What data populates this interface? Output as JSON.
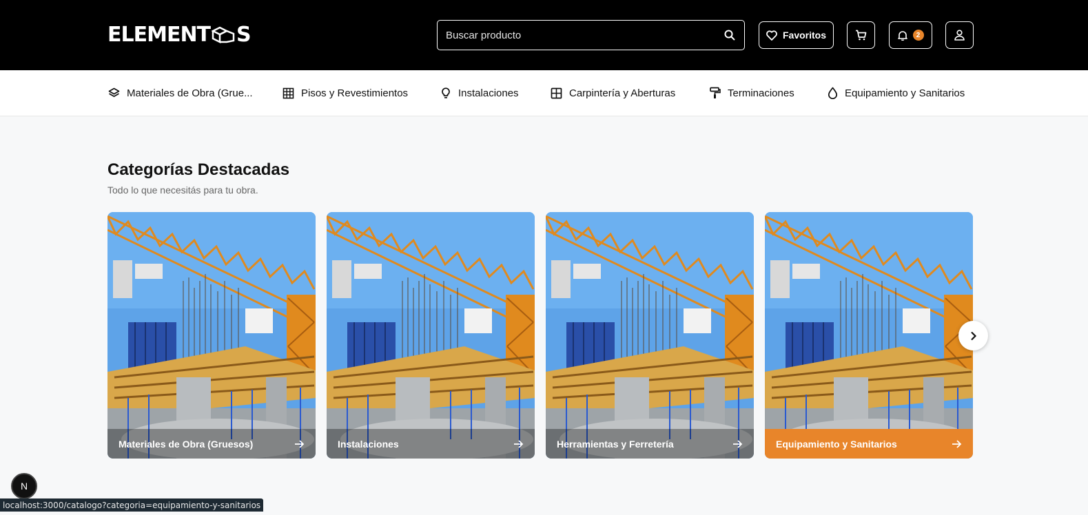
{
  "header": {
    "logo_left": "ELEMENT",
    "logo_right": "S",
    "search_placeholder": "Buscar producto",
    "favorites_label": "Favoritos",
    "notification_count": "2"
  },
  "nav": {
    "items": [
      {
        "label": "Materiales de Obra (Grue...",
        "icon": "layers-icon"
      },
      {
        "label": "Pisos y Revestimientos",
        "icon": "grid-icon"
      },
      {
        "label": "Instalaciones",
        "icon": "lightbulb-icon"
      },
      {
        "label": "Carpintería y Aberturas",
        "icon": "window-icon"
      },
      {
        "label": "Terminaciones",
        "icon": "paint-roller-icon"
      },
      {
        "label": "Equipamiento y Sanitarios",
        "icon": "droplet-icon"
      }
    ]
  },
  "section": {
    "title": "Categorías Destacadas",
    "subtitle": "Todo lo que necesitás para tu obra."
  },
  "cards": [
    {
      "label": "Materiales de Obra (Gruesos)",
      "active": false
    },
    {
      "label": "Instalaciones",
      "active": false
    },
    {
      "label": "Herramientas y Ferretería",
      "active": false
    },
    {
      "label": "Equipamiento y Sanitarios",
      "active": true
    }
  ],
  "colors": {
    "accent": "#e8852a",
    "header_bg": "#000000",
    "page_bg": "#f7f8f9"
  },
  "dev_badge": "N",
  "status_url": "localhost:3000/catalogo?categoria=equipamiento-y-sanitarios"
}
